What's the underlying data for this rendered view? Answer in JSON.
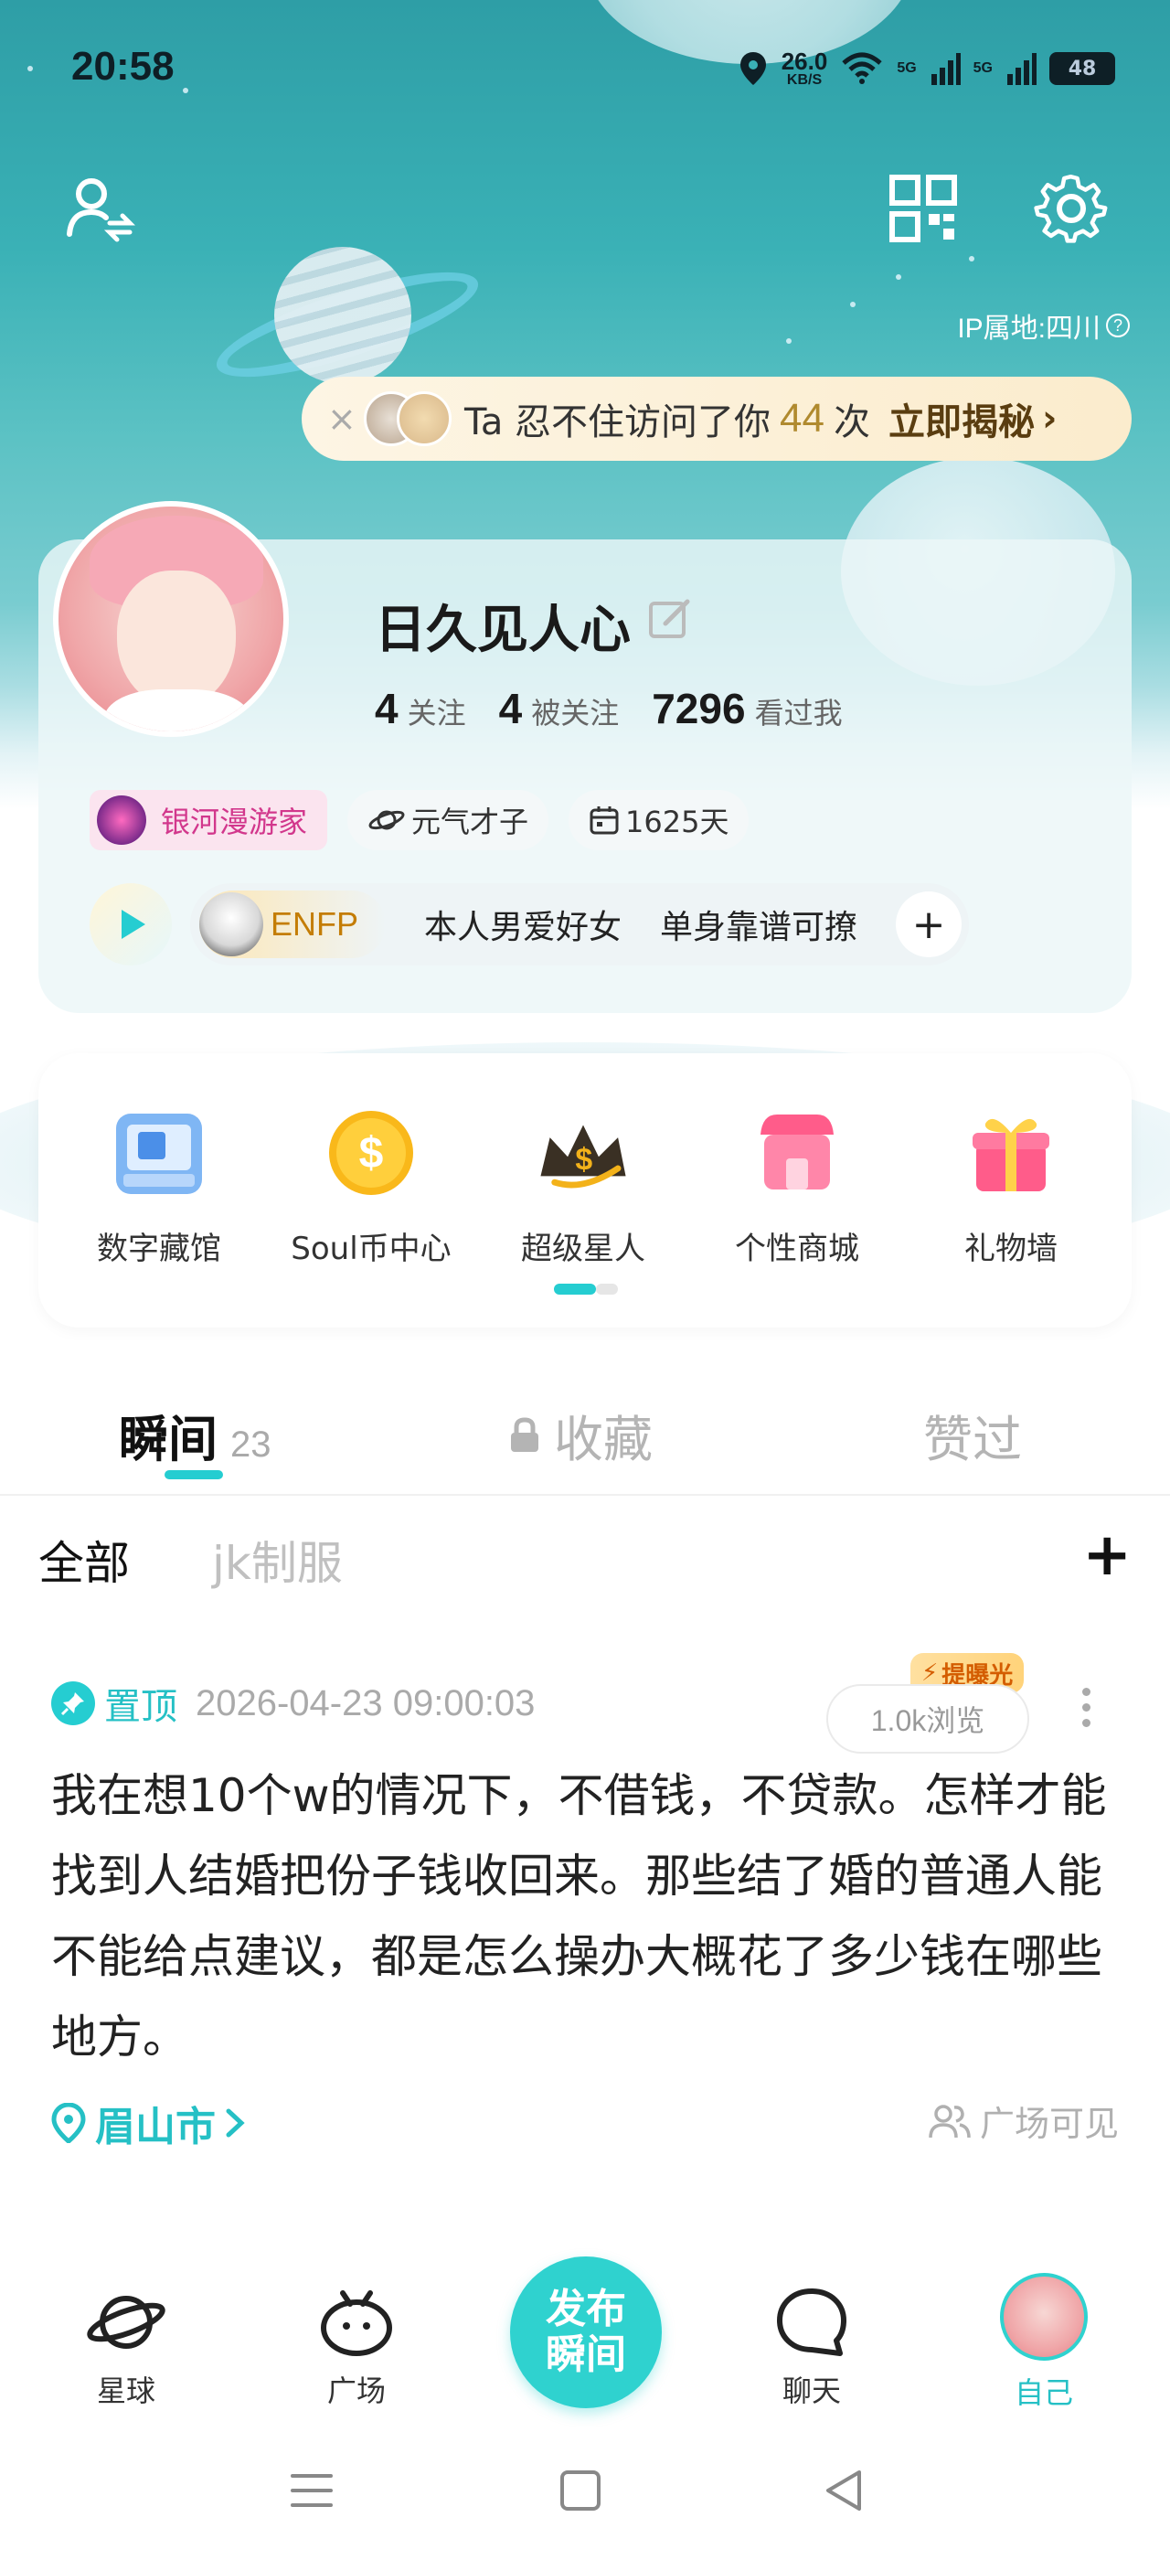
{
  "status_bar": {
    "time": "20:58",
    "net_speed": "26.0",
    "net_unit": "KB/S",
    "sig1": "5G",
    "sig2": "5G",
    "battery": "48"
  },
  "header": {
    "ip_location": "IP属地:四川",
    "ip_help": "?"
  },
  "visitor_banner": {
    "close": "×",
    "prefix": "Ta 忍不住访问了你",
    "count": "44",
    "suffix": "次",
    "cta": "立即揭秘",
    "chevron": "›"
  },
  "profile": {
    "nickname": "日久见人心",
    "following_count": "4",
    "following_label": "关注",
    "followers_count": "4",
    "followers_label": "被关注",
    "viewed_count": "7296",
    "viewed_label": "看过我",
    "badge": "银河漫游家",
    "tag_energy": "元气才子",
    "days": "1625天",
    "mbti": "ENFP",
    "tags": [
      "本人男爱好女",
      "单身靠谱可撩"
    ],
    "add_tag": "+"
  },
  "services": [
    {
      "label": "数字藏馆",
      "icon": "museum-icon"
    },
    {
      "label": "Soul币中心",
      "icon": "coin-icon"
    },
    {
      "label": "超级星人",
      "icon": "crown-icon"
    },
    {
      "label": "个性商城",
      "icon": "shop-icon"
    },
    {
      "label": "礼物墙",
      "icon": "gift-icon"
    }
  ],
  "tabs": [
    {
      "label": "瞬间",
      "count": "23"
    },
    {
      "label": "收藏"
    },
    {
      "label": "赞过"
    }
  ],
  "filters": {
    "all": "全部",
    "tag": "jk制服",
    "add": "+"
  },
  "post": {
    "pinned": "置顶",
    "datetime": "2026-04-23 09:00:03",
    "boost": "提曝光",
    "views": "1.0k浏览",
    "text": "我在想10个w的情况下，不借钱，不贷款。怎样才能找到人结婚把份子钱收回来。那些结了婚的普通人能不能给点建议，都是怎么操办大概花了多少钱在哪些地方。",
    "location": "眉山市",
    "visibility": "广场可见"
  },
  "bottom_nav": {
    "planet": "星球",
    "square": "广场",
    "publish_line1": "发布",
    "publish_line2": "瞬间",
    "chat": "聊天",
    "me": "自己"
  },
  "colors": {
    "accent": "#25cdd1",
    "pinned_text": "#25c0c5",
    "mbti": "#c47d05",
    "galaxy_badge": "#d2378c"
  }
}
